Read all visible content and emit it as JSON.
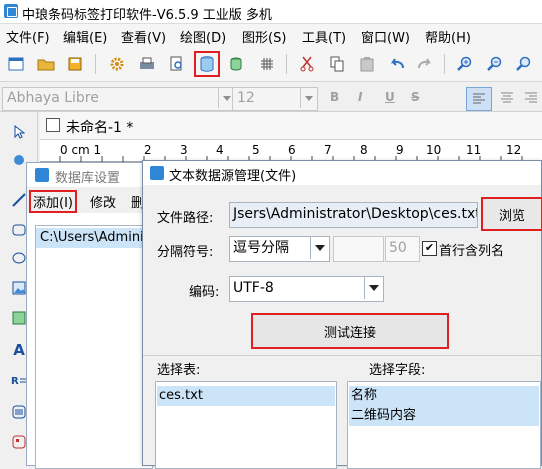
{
  "app": {
    "title": "中琅条码标签打印软件-V6.5.9 工业版 多机"
  },
  "menu": [
    {
      "label": "文件(F)"
    },
    {
      "label": "编辑(E)"
    },
    {
      "label": "查看(V)"
    },
    {
      "label": "绘图(D)"
    },
    {
      "label": "图形(S)"
    },
    {
      "label": "工具(T)"
    },
    {
      "label": "窗口(W)"
    },
    {
      "label": "帮助(H)"
    }
  ],
  "fontbar": {
    "font_name": "Abhaya Libre",
    "font_size": "12",
    "bold": "B",
    "italic": "I",
    "underline": "U",
    "strike": "S"
  },
  "document": {
    "tab_title": "未命名-1 *",
    "ruler_numbers": [
      "0 cm 1",
      "2",
      "3",
      "4",
      "5",
      "6",
      "7",
      "8",
      "9",
      "10",
      "11",
      "12"
    ]
  },
  "db_window": {
    "title": "数据库设置",
    "toolbar": {
      "add": "添加(I)",
      "edit": "修改",
      "delete": "删"
    },
    "list_items": [
      "C:\\Users\\Administrator\\Desktop\\ces.txt"
    ]
  },
  "txt_window": {
    "title": "文本数据源管理(文件)",
    "file_path_label": "文件路径:",
    "file_path_value": "Jsers\\Administrator\\Desktop\\ces.txt",
    "browse_button": "浏览",
    "separator_label": "分隔符号:",
    "separator_value": "逗号分隔",
    "separator_custom": "",
    "separator_number": "50",
    "first_row_header": "首行含列名",
    "first_row_checked": true,
    "encoding_label": "编码:",
    "encoding_value": "UTF-8",
    "test_button": "测试连接",
    "table_label": "选择表:",
    "tables": [
      "ces.txt"
    ],
    "field_label": "选择字段:",
    "fields": [
      "名称",
      "二维码内容"
    ]
  },
  "colors": {
    "accent": "#2f86d6",
    "highlight": "#e02020",
    "selection": "#cce4f7"
  }
}
